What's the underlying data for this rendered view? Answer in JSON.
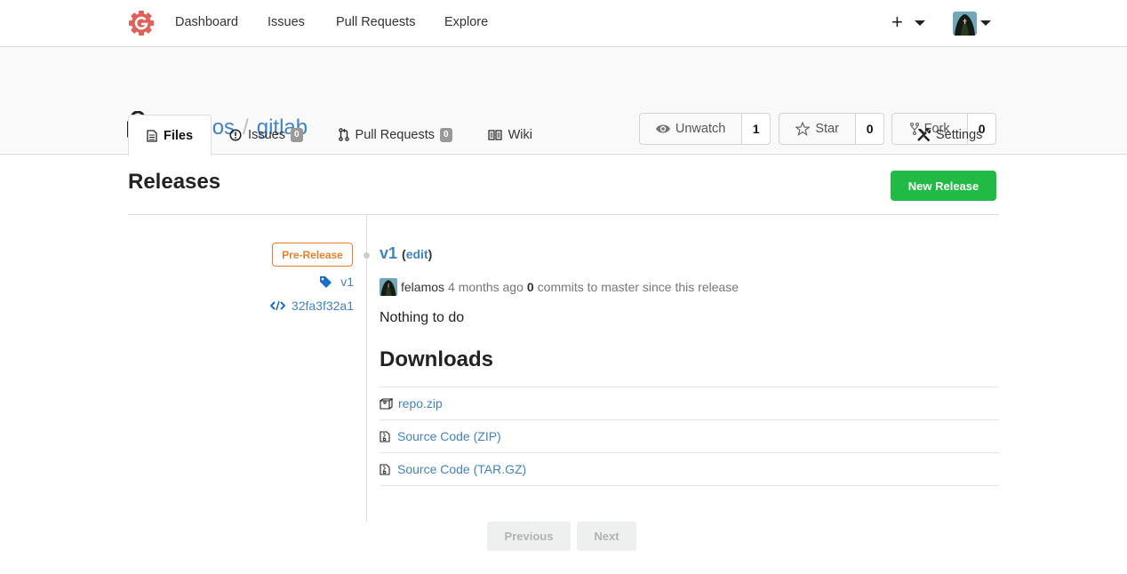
{
  "topbar": {
    "nav": [
      "Dashboard",
      "Issues",
      "Pull Requests",
      "Explore"
    ],
    "create_icon": "plus-icon",
    "avatar_icon": "user-avatar"
  },
  "repo": {
    "owner": "felamos",
    "separator": "/",
    "name": "gitlab",
    "private_icon": "lock-icon",
    "watch": {
      "label": "Unwatch",
      "count": "1"
    },
    "star": {
      "label": "Star",
      "count": "0"
    },
    "fork": {
      "label": "Fork",
      "count": "0"
    },
    "tabs": [
      {
        "label": "Files",
        "active": true
      },
      {
        "label": "Issues",
        "badge": "0"
      },
      {
        "label": "Pull Requests",
        "badge": "0"
      },
      {
        "label": "Wiki"
      }
    ],
    "settings_label": "Settings"
  },
  "releases": {
    "title": "Releases",
    "new_release_label": "New Release",
    "items": [
      {
        "status_badge": "Pre-Release",
        "tag": "v1",
        "commit": "32fa3f32a1",
        "title": "v1",
        "edit_label": "edit",
        "author": "felamos",
        "time": "4 months ago",
        "commits_count": "0",
        "commits_text": "commits to master since this release",
        "note": "Nothing to do",
        "downloads_title": "Downloads",
        "downloads": [
          {
            "label": "repo.zip",
            "icon": "package-icon"
          },
          {
            "label": "Source Code (ZIP)",
            "icon": "file-zip-icon"
          },
          {
            "label": "Source Code (TAR.GZ)",
            "icon": "file-zip-icon"
          }
        ]
      }
    ],
    "pagination": {
      "previous": "Previous",
      "next": "Next"
    }
  },
  "colors": {
    "link": "#4183c4",
    "primary_green": "#21ba45",
    "prerelease_orange": "#e87f2e",
    "logo_red": "#e0605a"
  }
}
